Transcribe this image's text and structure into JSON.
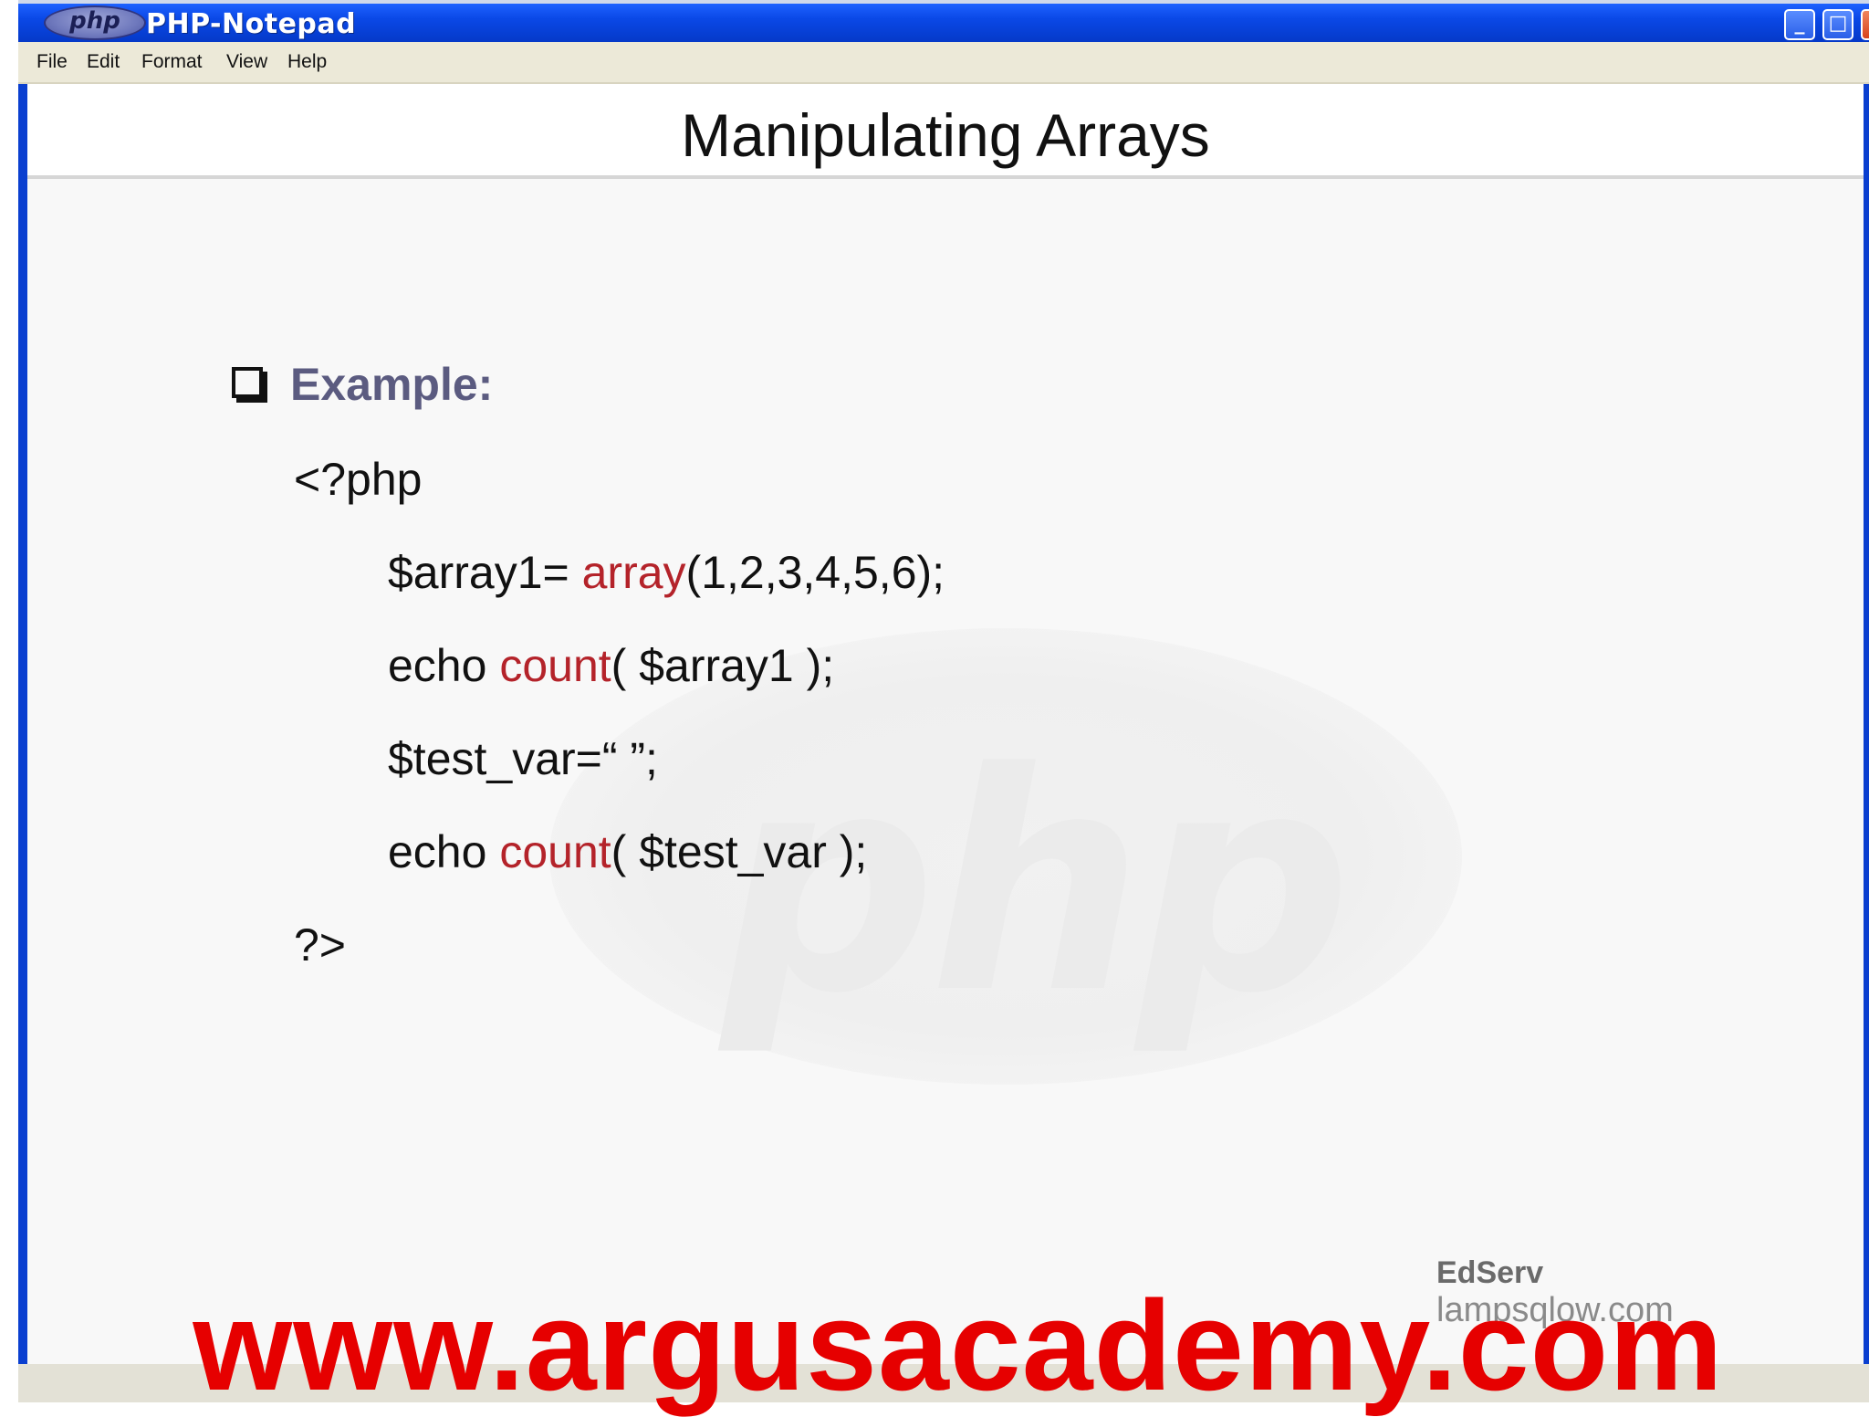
{
  "window": {
    "logo": "php",
    "title": "PHP-Notepad",
    "controls": {
      "minimize": "minimize-icon",
      "maximize": "maximize-icon",
      "close": "close-icon"
    }
  },
  "menubar": {
    "items": [
      "File",
      "Edit",
      "Format",
      "View",
      "Help"
    ]
  },
  "slide": {
    "title": "Manipulating Arrays",
    "bullet_label": "Example:",
    "code": {
      "open_tag": "<?php",
      "line1_a": "$array1= ",
      "line1_fn": "array",
      "line1_b": "(1,2,3,4,5,6);",
      "line2_a": "echo ",
      "line2_fn": "count",
      "line2_b": "( $array1 );",
      "line3": "$test_var=“ ”;",
      "line4_a": "echo ",
      "line4_fn": "count",
      "line4_b": "( $test_var );",
      "close_tag": "?>"
    },
    "watermark": "php",
    "footer": {
      "brand": "EdServ",
      "site": "lampsqlow.com"
    }
  },
  "overlay": {
    "url": "www.argusacademy.com"
  },
  "colors": {
    "keyword": "#b4232a",
    "overlay": "#e60000",
    "titlebar": "#0a48e6"
  }
}
